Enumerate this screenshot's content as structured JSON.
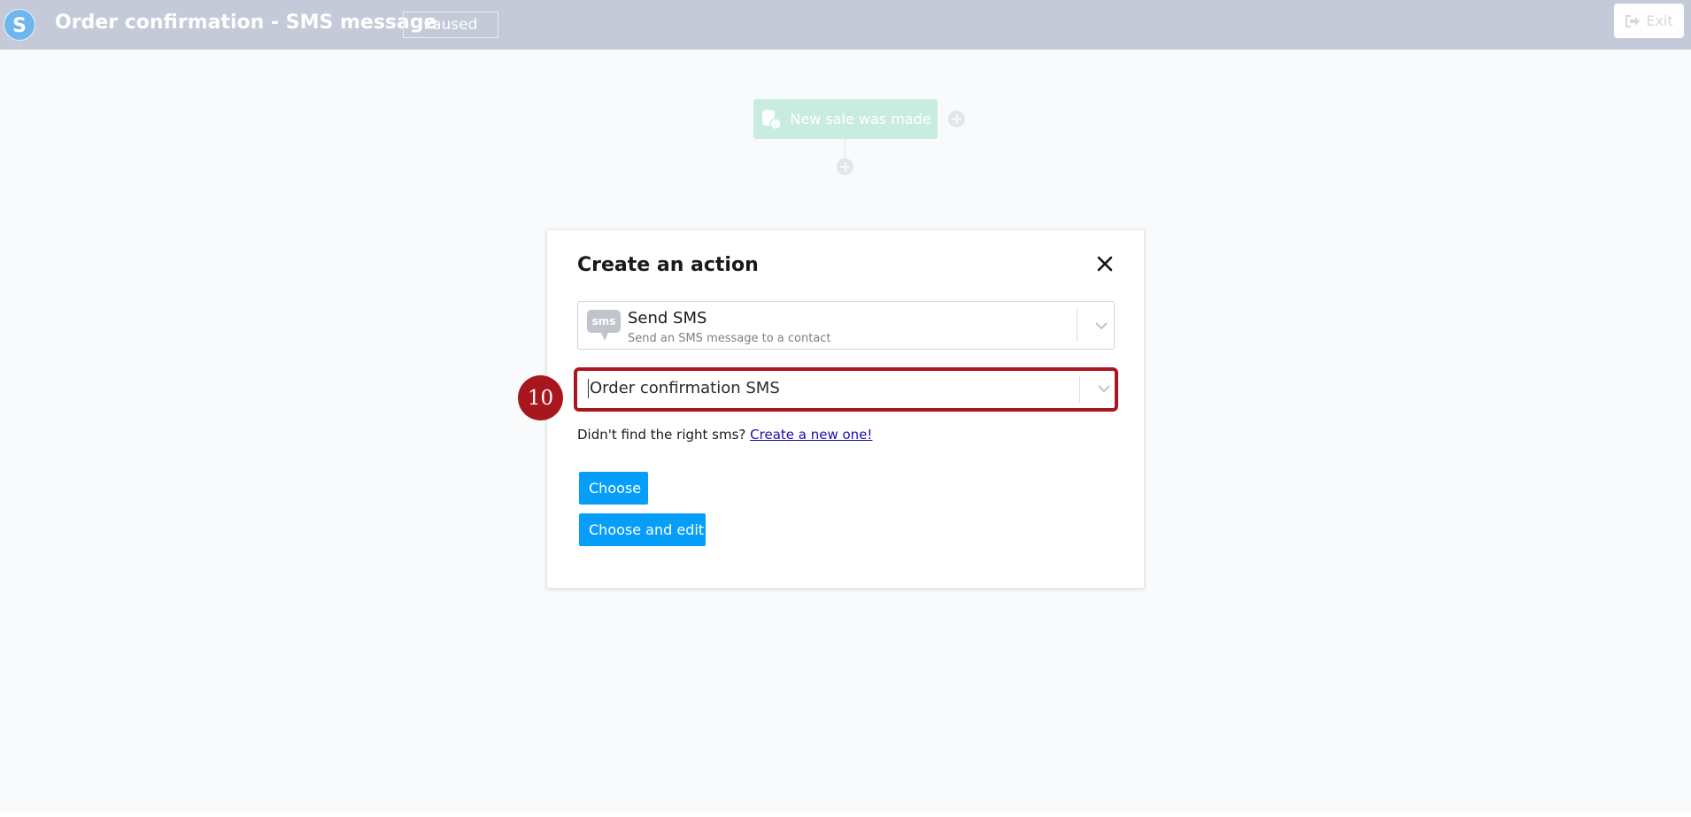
{
  "header": {
    "app_logo_letter": "S",
    "title": "Order confirmation - SMS message",
    "status": "Paused",
    "exit_label": "Exit"
  },
  "workflow": {
    "trigger_label": "New sale was made"
  },
  "modal": {
    "title": "Create an action",
    "action_select": {
      "icon_text": "sms",
      "label": "Send SMS",
      "description": "Send an SMS message to a contact"
    },
    "sms_select": {
      "value": "Order confirmation SMS"
    },
    "helper_text": "Didn't find the right sms?",
    "create_link": "Create a new one!",
    "choose_label": "Choose",
    "choose_edit_label": "Choose and edit"
  },
  "annotation": {
    "step_number": "10"
  },
  "colors": {
    "topbar": "#c5cad9",
    "primary_button": "#079ef9",
    "highlight": "#a8171e",
    "trigger_node": "#c8ede0"
  }
}
